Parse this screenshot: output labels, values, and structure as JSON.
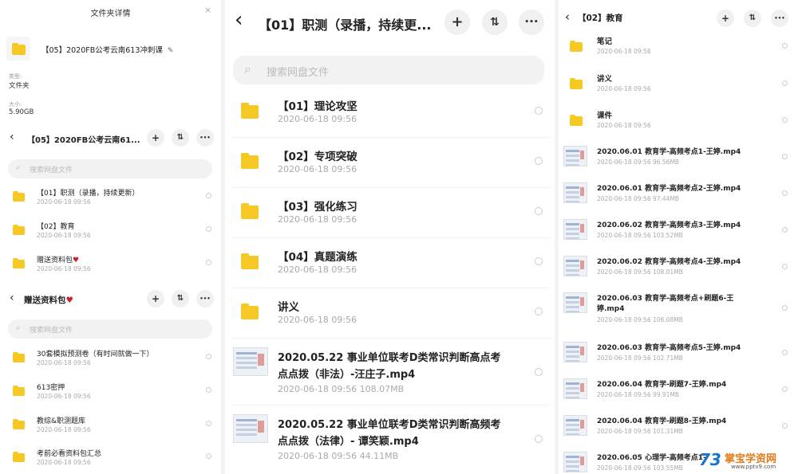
{
  "panel1": {
    "details_title": "文件夹详情",
    "close_icon": "×",
    "folder_name": "【05】2020FB公考云南613冲刺课",
    "type_label": "类型:",
    "type_value": "文件夹",
    "size_label": "大小:",
    "size_value": "5.90GB",
    "section1": {
      "title": "【05】2020FB公考云南61...",
      "search_placeholder": "搜索网盘文件",
      "items": [
        {
          "name": "【01】职测（录播，持续更新）",
          "date": "2020-06-18  09:56"
        },
        {
          "name": "【02】教育",
          "date": "2020-06-18  09:56"
        },
        {
          "name": "赠送资料包",
          "date": "2020-06-18  09:56",
          "heart": "♥"
        }
      ]
    },
    "section2": {
      "title": "赠送资料包",
      "heart": "♥",
      "search_placeholder": "搜索网盘文件",
      "items": [
        {
          "name": "30套模拟预测卷（有时间就做一下）",
          "date": "2020-06-18  09:56"
        },
        {
          "name": "613密押",
          "date": "2020-06-18  09:56"
        },
        {
          "name": "教综&职测题库",
          "date": "2020-06-18  09:56"
        },
        {
          "name": "考前必看资料包汇总",
          "date": "2020-06-18  09:56"
        }
      ]
    }
  },
  "panel2": {
    "title": "【01】职测（录播，持续更...",
    "search_placeholder": "搜索网盘文件",
    "items": [
      {
        "name": "【01】理论攻坚",
        "meta": "2020-06-18  09:56",
        "kind": "folder"
      },
      {
        "name": "【02】专项突破",
        "meta": "2020-06-18  09:56",
        "kind": "folder"
      },
      {
        "name": "【03】强化练习",
        "meta": "2020-06-18  09:56",
        "kind": "folder"
      },
      {
        "name": "【04】真题演练",
        "meta": "2020-06-18  09:56",
        "kind": "folder"
      },
      {
        "name": "讲义",
        "meta": "2020-06-18  09:56",
        "kind": "folder"
      },
      {
        "name": "2020.05.22 事业单位联考D类常识判断高点考",
        "name2": "点点拨（非法）-汪庄子.mp4",
        "meta": "2020-06-18  09:56  108.07MB",
        "kind": "video"
      },
      {
        "name": "2020.05.22 事业单位联考D类常识判断高频考",
        "name2": "点点拨（法律）- 谭笑颖.mp4",
        "meta": "2020-06-18  09:56  44.11MB",
        "kind": "video"
      }
    ]
  },
  "panel3": {
    "title": "【02】教育",
    "items": [
      {
        "name": "笔记",
        "meta": "2020-06-18  09:56",
        "kind": "folder"
      },
      {
        "name": "讲义",
        "meta": "2020-06-18  09:56",
        "kind": "folder"
      },
      {
        "name": "课件",
        "meta": "2020-06-18  09:56",
        "kind": "folder"
      },
      {
        "name": "2020.06.01 教育学-高频考点1-王婷.mp4",
        "meta": "2020-06-18  09:56  96.56MB",
        "kind": "video"
      },
      {
        "name": "2020.06.01 教育学-高频考点2-王婷.mp4",
        "meta": "2020-06-18  09:56  97.44MB",
        "kind": "video"
      },
      {
        "name": "2020.06.02 教育学-高频考点3-王婷.mp4",
        "meta": "2020-06-18  09:56  103.52MB",
        "kind": "video"
      },
      {
        "name": "2020.06.02 教育学-高频考点4-王婷.mp4",
        "meta": "2020-06-18  09:56  108.01MB",
        "kind": "video"
      },
      {
        "name": "2020.06.03 教育学-高频考点+刷题6-王",
        "name2": "婷.mp4",
        "meta": "2020-06-18  09:56  106.08MB",
        "kind": "video"
      },
      {
        "name": "2020.06.03 教育学-高频考点5-王婷.mp4",
        "meta": "2020-06-18  09:56  102.71MB",
        "kind": "video"
      },
      {
        "name": "2020.06.04 教育学-刷题7-王婷.mp4",
        "meta": "2020-06-18  09:56  99.91MB",
        "kind": "video"
      },
      {
        "name": "2020.06.04 教育学-刷题8-王婷.mp4",
        "meta": "2020-06-18  09:56  101.31MB",
        "kind": "video"
      },
      {
        "name": "2020.06.05 心理学-高频考点1-",
        "meta": "2020-06-18  09:56  103.55MB",
        "kind": "video"
      }
    ]
  },
  "toolbar": {
    "back": "‹",
    "add": "+",
    "sort": "⇅",
    "more": "•••"
  },
  "watermark": {
    "logo": "73",
    "text": "掌宝学资网",
    "url": "www.pptv9.com"
  },
  "colors": {
    "folder": "#f6c823",
    "search_bg": "#f2f2f2",
    "meta": "#aaaaaa"
  }
}
